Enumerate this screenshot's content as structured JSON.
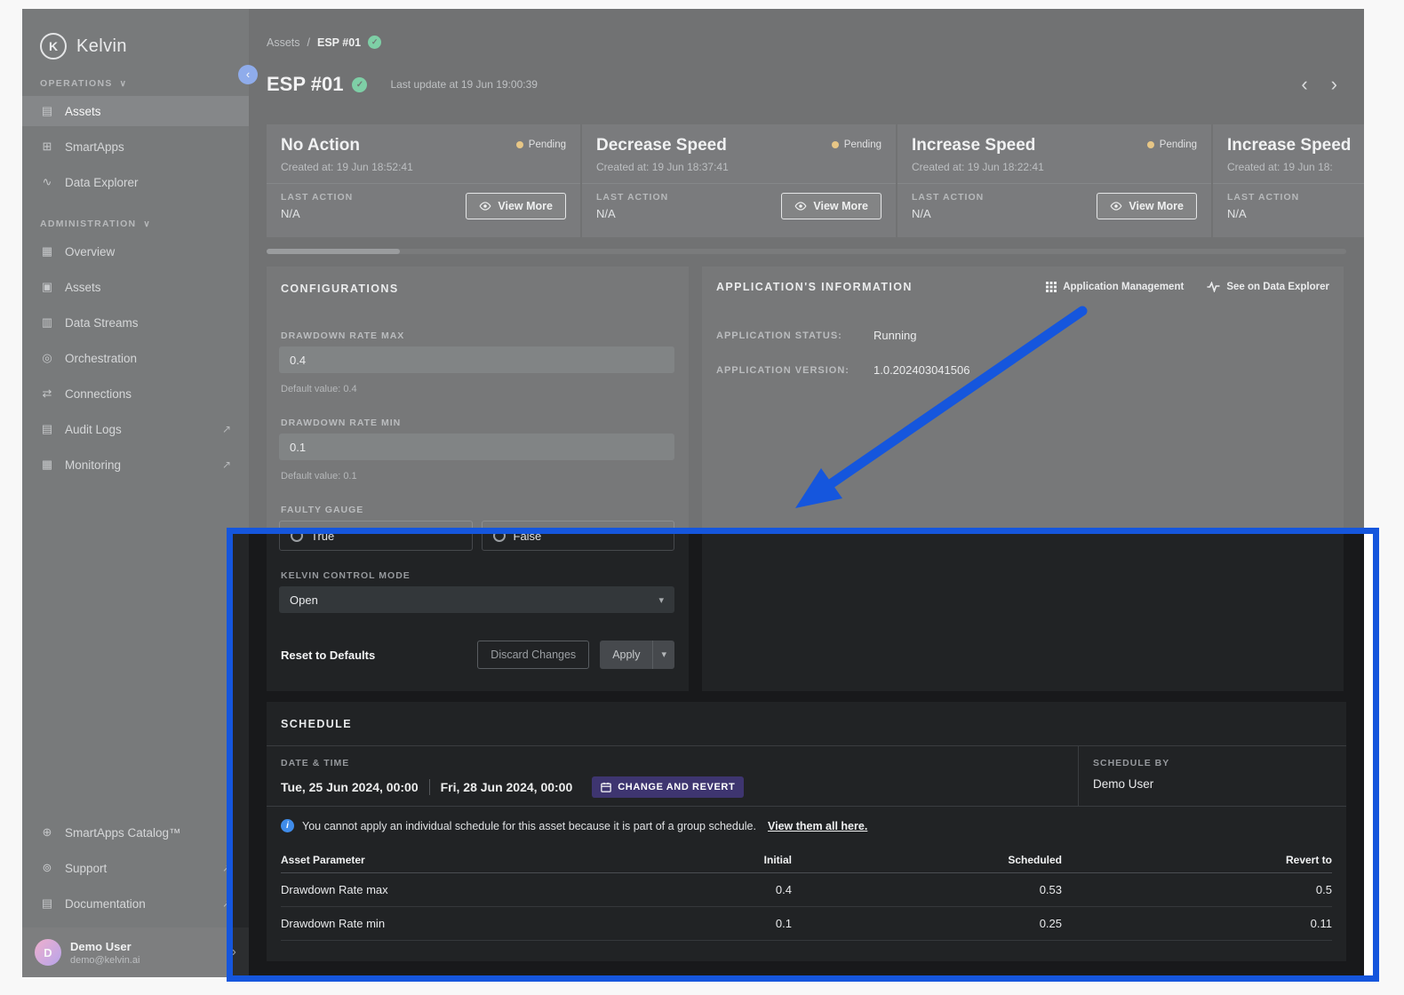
{
  "colors": {
    "highlight_blue": "#1556dd",
    "pending_amber": "#e2a93c",
    "success_green": "#2eb872",
    "schedule_button_purple": "#3e3570"
  },
  "icons": {
    "chevron_down": "∨",
    "chevron_left": "‹",
    "chevron_right": "›",
    "check": "✓",
    "external_link": "↗",
    "select_caret": "▾",
    "info": "i",
    "assets_operations": "▤",
    "smartapps": "⊞",
    "data_explorer": "∿",
    "overview": "▦",
    "assets_admin": "▣",
    "data_streams": "▥",
    "orchestration": "◎",
    "connections": "⇄",
    "audit_logs": "▤",
    "monitoring": "▦",
    "catalog": "⊕",
    "support": "⊚",
    "documentation": "▤"
  },
  "sidebar": {
    "logo_letter": "K",
    "logo_text": "Kelvin",
    "sections": [
      {
        "label": "OPERATIONS",
        "items": [
          {
            "label": "Assets"
          },
          {
            "label": "SmartApps"
          },
          {
            "label": "Data Explorer"
          }
        ]
      },
      {
        "label": "ADMINISTRATION",
        "items": [
          {
            "label": "Overview"
          },
          {
            "label": "Assets"
          },
          {
            "label": "Data Streams"
          },
          {
            "label": "Orchestration"
          },
          {
            "label": "Connections"
          },
          {
            "label": "Audit Logs"
          },
          {
            "label": "Monitoring"
          }
        ]
      }
    ],
    "footer_items": [
      {
        "label": "SmartApps Catalog™"
      },
      {
        "label": "Support"
      },
      {
        "label": "Documentation"
      }
    ],
    "user": {
      "initial": "D",
      "name": "Demo User",
      "email": "demo@kelvin.ai"
    }
  },
  "header": {
    "breadcrumb_root": "Assets",
    "breadcrumb_separator": "/",
    "breadcrumb_current": "ESP #01",
    "title": "ESP #01",
    "last_update": "Last update at 19 Jun 19:00:39"
  },
  "card_labels": {
    "last_action": "LAST ACTION",
    "view_more": "View More"
  },
  "action_cards": [
    {
      "title": "No Action",
      "status": "Pending",
      "created": "Created at: 19 Jun 18:52:41",
      "last_action_value": "N/A"
    },
    {
      "title": "Decrease Speed",
      "status": "Pending",
      "created": "Created at: 19 Jun 18:37:41",
      "last_action_value": "N/A"
    },
    {
      "title": "Increase Speed",
      "status": "Pending",
      "created": "Created at: 19 Jun 18:22:41",
      "last_action_value": "N/A"
    },
    {
      "title": "Increase Speed",
      "status": "Pending",
      "created": "Created at: 19 Jun 18:",
      "last_action_value": "N/A"
    }
  ],
  "configurations": {
    "title": "CONFIGURATIONS",
    "drawdown_max": {
      "label": "DRAWDOWN RATE MAX",
      "value": "0.4",
      "default": "Default value: 0.4"
    },
    "drawdown_min": {
      "label": "DRAWDOWN RATE MIN",
      "value": "0.1",
      "default": "Default value: 0.1"
    },
    "faulty_gauge": {
      "label": "FAULTY GAUGE",
      "options": [
        "True",
        "False"
      ]
    },
    "control_mode": {
      "label": "KELVIN CONTROL MODE",
      "value": "Open"
    },
    "buttons": {
      "reset": "Reset to Defaults",
      "discard": "Discard Changes",
      "apply": "Apply"
    }
  },
  "application_info": {
    "title": "APPLICATION'S INFORMATION",
    "actions": {
      "management": "Application Management",
      "explorer": "See on Data Explorer"
    },
    "status_label": "APPLICATION STATUS:",
    "status_value": "Running",
    "version_label": "APPLICATION VERSION:",
    "version_value": "1.0.202403041506"
  },
  "schedule": {
    "title": "SCHEDULE",
    "datetime_label": "DATE & TIME",
    "start": "Tue, 25 Jun 2024, 00:00",
    "end": "Fri, 28 Jun 2024, 00:00",
    "change_button": "CHANGE AND REVERT",
    "by_label": "SCHEDULE BY",
    "by_value": "Demo User",
    "notice": "You cannot apply an individual schedule for this asset because it is part of a group schedule.",
    "notice_link": "View them all here.",
    "table": {
      "headers": [
        "Asset Parameter",
        "Initial",
        "Scheduled",
        "Revert to"
      ],
      "rows": [
        {
          "parameter": "Drawdown Rate max",
          "initial": "0.4",
          "scheduled": "0.53",
          "revert": "0.5"
        },
        {
          "parameter": "Drawdown Rate min",
          "initial": "0.1",
          "scheduled": "0.25",
          "revert": "0.11"
        }
      ]
    }
  }
}
